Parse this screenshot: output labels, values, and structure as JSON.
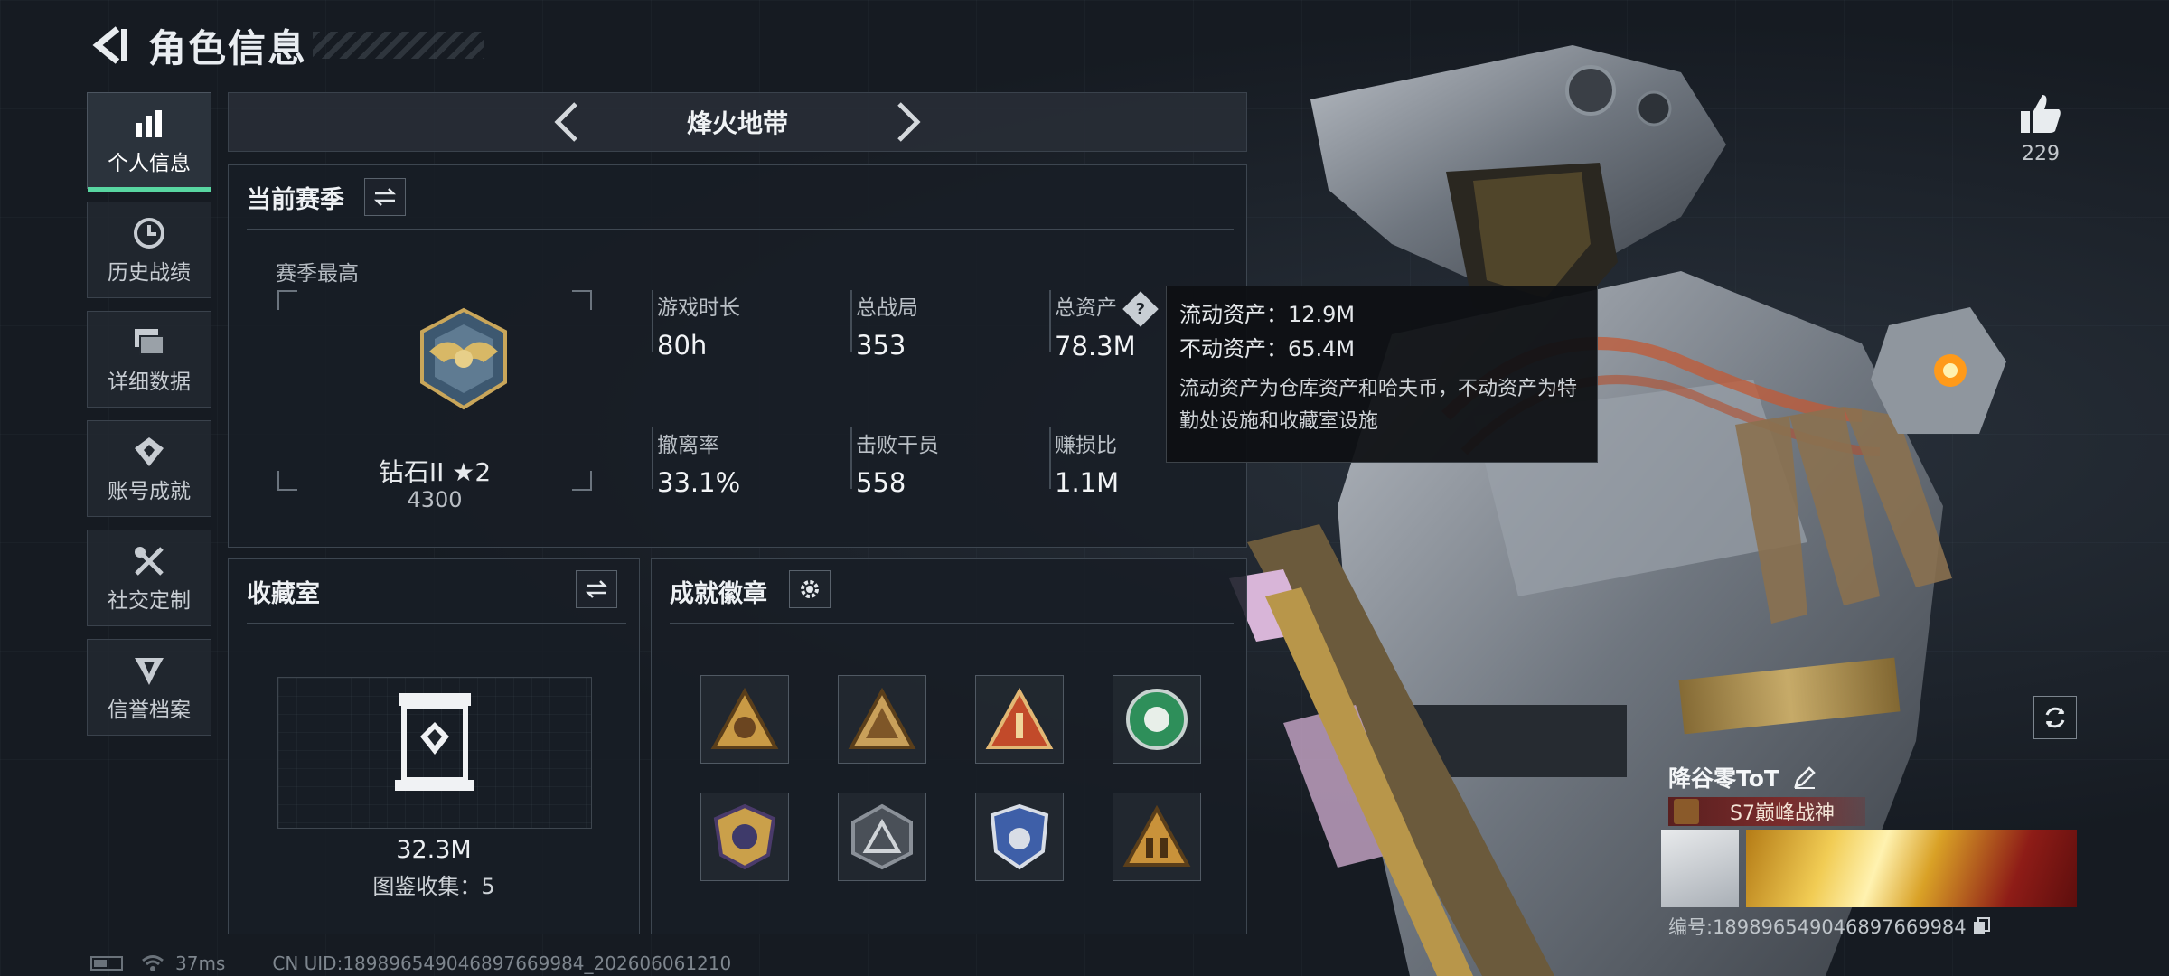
{
  "header": {
    "title": "角色信息"
  },
  "nav": {
    "items": [
      {
        "label": "个人信息",
        "icon": "bar-chart-icon",
        "active": true
      },
      {
        "label": "历史战绩",
        "icon": "clock-history-icon"
      },
      {
        "label": "详细数据",
        "icon": "stacked-cards-icon"
      },
      {
        "label": "账号成就",
        "icon": "achievement-icon"
      },
      {
        "label": "社交定制",
        "icon": "wrench-tools-icon"
      },
      {
        "label": "信誉档案",
        "icon": "shield-emblem-icon"
      }
    ]
  },
  "mode": {
    "name": "烽火地带"
  },
  "season": {
    "title": "当前赛季",
    "best_label": "赛季最高",
    "rank_name": "钻石II ★2",
    "rank_score": "4300",
    "stats": [
      {
        "label": "游戏时长",
        "value": "80h"
      },
      {
        "label": "总战局",
        "value": "353"
      },
      {
        "label": "总资产",
        "value": "78.3M"
      },
      {
        "label": "撤离率",
        "value": "33.1%"
      },
      {
        "label": "击败干员",
        "value": "558"
      },
      {
        "label": "赚损比",
        "value": "1.1M"
      }
    ],
    "help_glyph": "?"
  },
  "tooltip": {
    "liquid": "流动资产：12.9M",
    "fixed": "不动资产：65.4M",
    "description": "流动资产为仓库资产和哈夫币，不动资产为特勤处设施和收藏室设施"
  },
  "collection": {
    "title": "收藏室",
    "value": "32.3M",
    "count": "图鉴收集：5"
  },
  "badges": {
    "title": "成就徽章",
    "items": [
      "badge-triangle-helmet",
      "badge-triangle-pyramid",
      "badge-triangle-number-one",
      "badge-green-shield",
      "badge-gold-crest",
      "badge-grey-triangle",
      "badge-blue-shield",
      "badge-gold-soldiers"
    ]
  },
  "player": {
    "likes": "229",
    "name": "降谷零ToT",
    "title_badge": "S7巅峰战神",
    "id": "编号:18989654904689766998​4"
  },
  "status": {
    "ping": "37ms",
    "uid": "CN UID:18989654904689766998​4_202606061210"
  },
  "colors": {
    "accent": "#58d6a1",
    "panel_bg": "#181e25",
    "title_badge_bg": "#7a2c2c"
  }
}
